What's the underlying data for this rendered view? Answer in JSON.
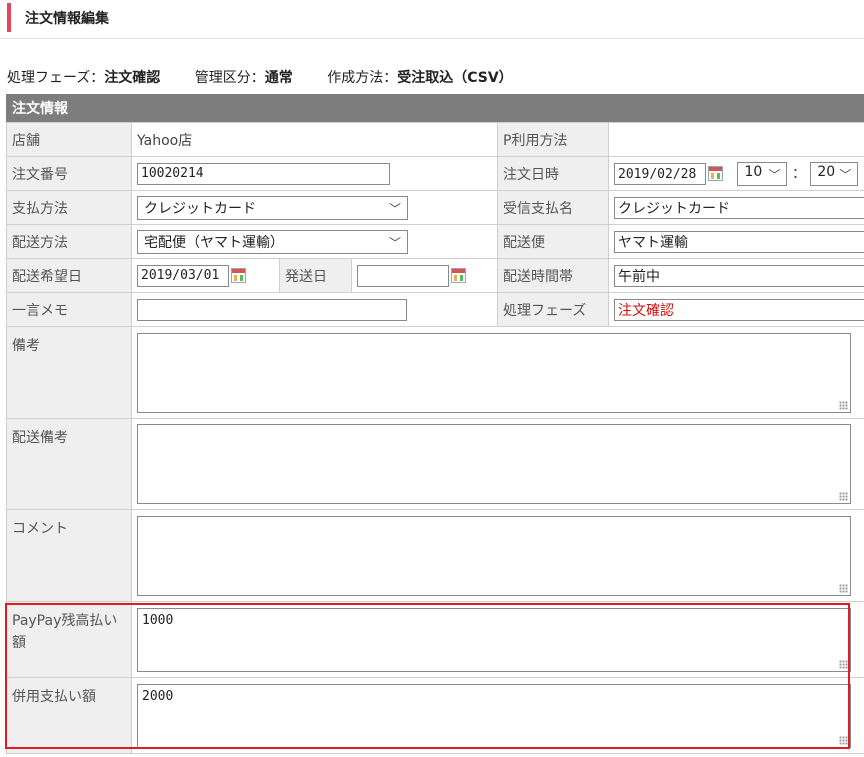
{
  "header": {
    "title": "注文情報編集"
  },
  "info": [
    {
      "label": "処理フェーズ：",
      "value": "注文確認"
    },
    {
      "label": "管理区分：",
      "value": "通常"
    },
    {
      "label": "作成方法：",
      "value": "受注取込（CSV）"
    }
  ],
  "section": {
    "title": "注文情報"
  },
  "fields": {
    "store_label": "店舗",
    "store_value": "Yahoo店",
    "p_usage_label": "P利用方法",
    "order_no_label": "注文番号",
    "order_no": "10020214",
    "order_datetime_label": "注文日時",
    "order_date": "2019/02/28",
    "order_hour": "10",
    "order_min": "20",
    "time_sep": "：",
    "payment_label": "支払方法",
    "payment": "クレジットカード",
    "recv_payment_label": "受信支払名",
    "recv_payment": "クレジットカード",
    "ship_method_label": "配送方法",
    "ship_method": "宅配便（ヤマト運輸）",
    "carrier_label": "配送便",
    "carrier": "ヤマト運輸",
    "desired_date_label": "配送希望日",
    "desired_date": "2019/03/01",
    "ship_date_label": "発送日",
    "ship_date": "",
    "time_slot_label": "配送時間帯",
    "time_slot": "午前中",
    "memo_label": "一言メモ",
    "memo": "",
    "phase_label": "処理フェーズ",
    "phase": "注文確認",
    "remarks_label": "備考",
    "remarks": "",
    "ship_remarks_label": "配送備考",
    "ship_remarks": "",
    "comment_label": "コメント",
    "comment": "",
    "paypay_label": "PayPay残高払い額",
    "paypay": "1000",
    "combined_label": "併用支払い額",
    "combined": "2000"
  },
  "colors": {
    "accent": "#e8445a",
    "section_bg": "#7d7d7d",
    "highlight": "#e01b24",
    "phase_text": "#cc1111"
  }
}
